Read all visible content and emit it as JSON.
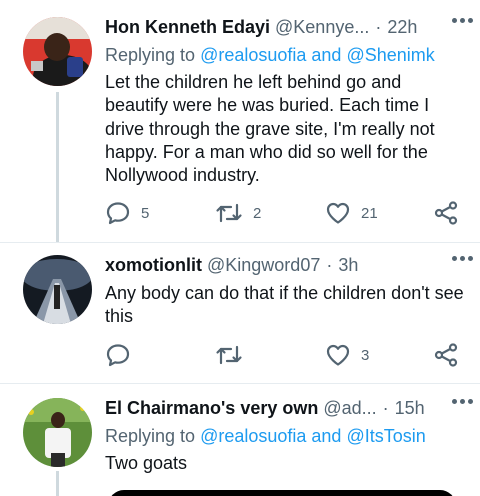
{
  "tweets": [
    {
      "name": "Hon Kenneth Edayi",
      "handle": "@Kennye...",
      "separator": "·",
      "time": "22h",
      "reply_prefix": "Replying to",
      "reply_users": "@realosuofia and @Shenimk",
      "text": "Let the children he left behind go and beautify were he was buried. Each time I drive through the grave site, I'm really not happy. For a man who did so well for the Nollywood industry.",
      "reply_count": "5",
      "retweet_count": "2",
      "like_count": "21"
    },
    {
      "name": "xomotionlit",
      "handle": "@Kingword07",
      "separator": "·",
      "time": "3h",
      "text": "Any body can do that if the children don't see this",
      "reply_count": "",
      "retweet_count": "",
      "like_count": "3"
    },
    {
      "name": "El Chairmano's very own",
      "handle": "@ad...",
      "separator": "·",
      "time": "15h",
      "reply_prefix": "Replying to",
      "reply_users": "@realosuofia and @ItsTosin",
      "text": "Two goats"
    }
  ],
  "icons": {
    "reply": "reply-icon",
    "retweet": "retweet-icon",
    "like": "heart-icon",
    "share": "share-icon",
    "more": "more-icon"
  },
  "colors": {
    "text": "#0f1419",
    "secondary": "#536471",
    "link": "#1d9bf0",
    "thread_line": "#cfd9de"
  }
}
